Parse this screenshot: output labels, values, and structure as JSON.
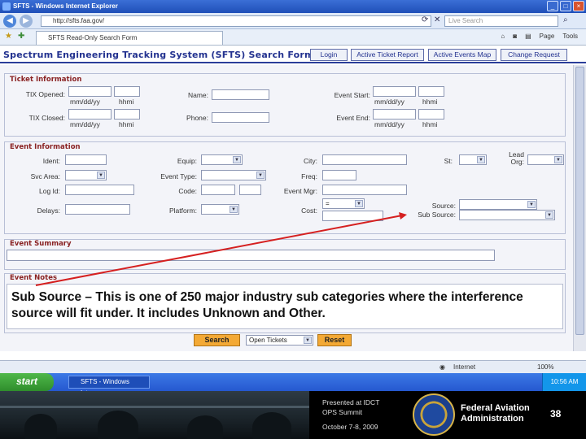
{
  "browser": {
    "title": "SFTS - Windows Internet Explorer",
    "address": "http://sfts.faa.gov/",
    "search_placeholder": "Live Search",
    "tab_label": "SFTS Read-Only Search Form",
    "tools": [
      "Page",
      "Tools"
    ],
    "status_text": "Internet",
    "zoom": "100%"
  },
  "app": {
    "title": "Spectrum Engineering Tracking System (SFTS) Search Form",
    "buttons": [
      "Login",
      "Active Ticket Report",
      "Active Events Map",
      "Change Request"
    ]
  },
  "ticket_info": {
    "title": "Ticket Information",
    "tix_opened": "TIX Opened:",
    "tix_closed": "TIX Closed:",
    "name": "Name:",
    "phone": "Phone:",
    "event_start": "Event Start:",
    "event_end": "Event End:",
    "date_hint": "mm/dd/yy",
    "time_hint": "hhmi"
  },
  "event_info": {
    "title": "Event Information",
    "ident": "Ident:",
    "equip": "Equip:",
    "city": "City:",
    "st": "St:",
    "lead_org": "Lead Org:",
    "svc_area": "Svc Area:",
    "event_type": "Event Type:",
    "freq": "Freq:",
    "log_id": "Log Id:",
    "code": "Code:",
    "event_mgr": "Event Mgr:",
    "delays": "Delays:",
    "platform": "Platform:",
    "cost": "Cost:",
    "cost_op": "=",
    "source": "Source:",
    "sub_source": "Sub Source:"
  },
  "event_summary": {
    "title": "Event Summary"
  },
  "event_notes": {
    "title": "Event Notes"
  },
  "callout": "Sub Source – This is one of 250 major industry sub categories where the interference source will fit under. It includes Unknown and Other.",
  "actions": {
    "search": "Search",
    "tickets_select": "Open Tickets",
    "reset": "Reset"
  },
  "taskbar": {
    "start": "start",
    "task_item": "SFTS - Windows Inter...",
    "clock": "10:56 AM"
  },
  "footer": {
    "presented": "Presented at IDCT",
    "ops": "OPS Summit",
    "date": "October 7-8, 2009",
    "faa_line1": "Federal Aviation",
    "faa_line2": "Administration",
    "page_number": "38"
  },
  "colors": {
    "section_title": "#8a2323",
    "app_title": "#22318f",
    "button_orange": "#f3a935",
    "arrow_red": "#d52020"
  }
}
